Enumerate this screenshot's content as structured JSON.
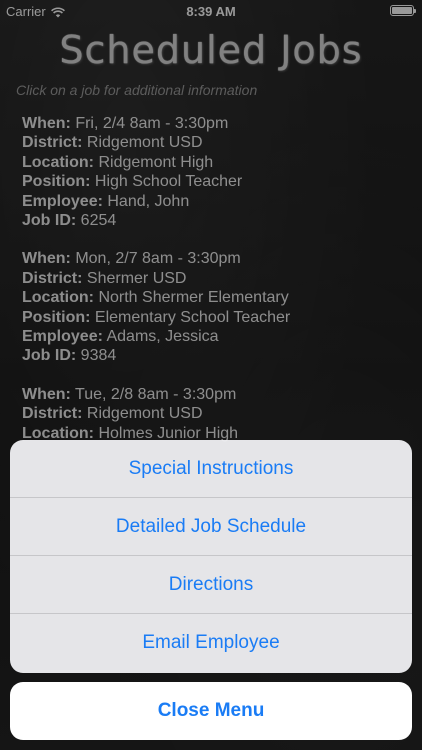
{
  "status_bar": {
    "carrier": "Carrier",
    "time": "8:39 AM"
  },
  "header": {
    "title": "Scheduled Jobs",
    "subtitle": "Click on a job for additional information"
  },
  "labels": {
    "when": "When:",
    "district": "District:",
    "location": "Location:",
    "position": "Position:",
    "employee": "Employee:",
    "job_id": "Job ID:"
  },
  "jobs": [
    {
      "when": "Fri, 2/4 8am - 3:30pm",
      "district": "Ridgemont USD",
      "location": "Ridgemont High",
      "position": "High School Teacher",
      "employee": "Hand, John",
      "job_id": "6254"
    },
    {
      "when": "Mon, 2/7 8am - 3:30pm",
      "district": "Shermer USD",
      "location": "North Shermer Elementary",
      "position": "Elementary School Teacher",
      "employee": "Adams, Jessica",
      "job_id": "9384"
    },
    {
      "when": "Tue, 2/8 8am - 3:30pm",
      "district": "Ridgemont USD",
      "location": "Holmes Junior High"
    }
  ],
  "action_sheet": {
    "items": [
      "Special Instructions",
      "Detailed Job Schedule",
      "Directions",
      "Email Employee"
    ],
    "cancel_label": "Close Menu"
  }
}
